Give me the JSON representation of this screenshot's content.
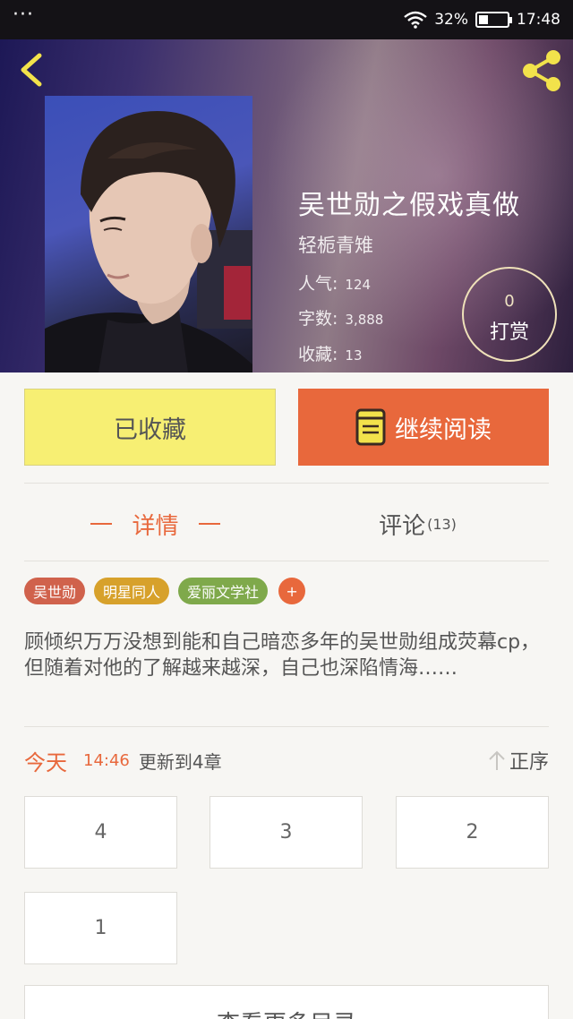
{
  "status_bar": {
    "menu": "···",
    "battery": "32%",
    "battery_level": 0.32,
    "time": "17:48"
  },
  "book": {
    "title": "吴世勋之假戏真做",
    "author": "轻栀青雉",
    "stats": [
      {
        "label": "人气:",
        "value": "124"
      },
      {
        "label": "字数:",
        "value": "3,888"
      },
      {
        "label": "收藏:",
        "value": "13"
      }
    ],
    "reward": {
      "count": "0",
      "label": "打赏"
    }
  },
  "actions": {
    "collected": "已收藏",
    "continue_reading": "继续阅读"
  },
  "tabs": {
    "details": "详情",
    "comments": "评论",
    "comments_count": "(13)"
  },
  "tags": [
    "吴世勋",
    "明星同人",
    "爱丽文学社"
  ],
  "tag_add": "+",
  "description": "顾倾织万万没想到能和自己暗恋多年的吴世勋组成荧幕cp，但随着对他的了解越来越深，自己也深陷情海……",
  "update": {
    "day": "今天",
    "time": "14:46",
    "text": "更新到4章",
    "sort": "正序"
  },
  "chapters": [
    "4",
    "3",
    "2",
    "1"
  ],
  "more_catalog": "查看更多目录",
  "colors": {
    "accent": "#e8683c",
    "yellow": "#f7ef73",
    "icon_yellow": "#f2e24b"
  },
  "icons": [
    "back-arrow-icon",
    "share-icon",
    "book-icon",
    "sort-up-arrow-icon",
    "wifi-icon",
    "battery-icon"
  ]
}
